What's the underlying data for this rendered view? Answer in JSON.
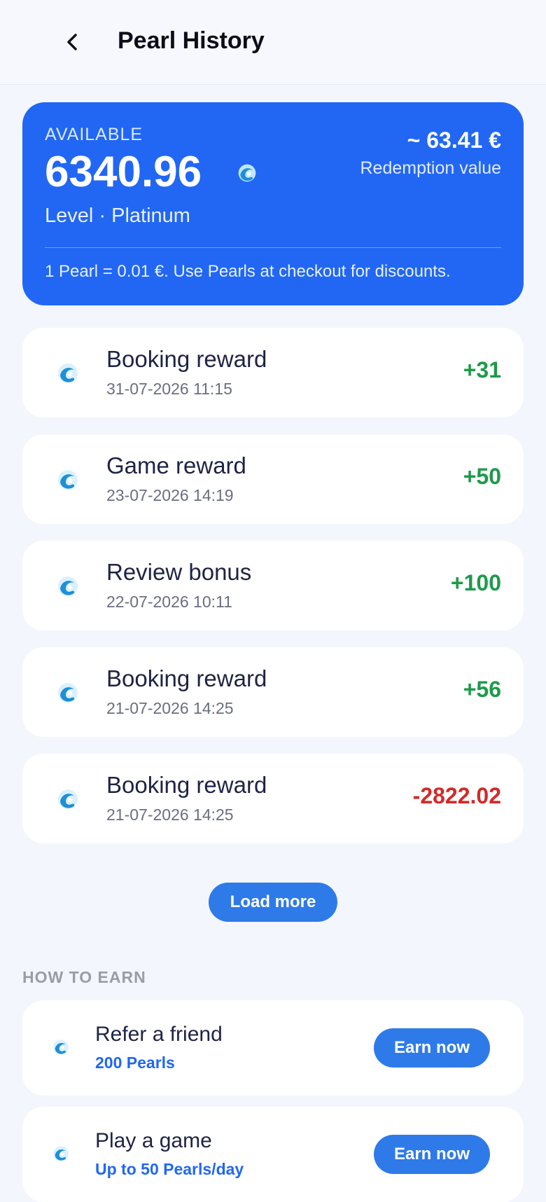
{
  "header": {
    "title": "Pearl History",
    "back_icon": "chevron-left-icon"
  },
  "balance": {
    "label": "AVAILABLE",
    "amount": "6340.96",
    "coin_icon": "pearl-icon",
    "level": "Level · Platinum",
    "value": "~ 63.41 €",
    "value_label": "Redemption value",
    "note": "1 Pearl = 0.01 €. Use Pearls at checkout for discounts.",
    "color": "#2167f3"
  },
  "transactions": [
    {
      "name": "Booking reward",
      "date": "31-07-2026 11:15",
      "amount": "+31"
    },
    {
      "name": "Game reward",
      "date": "23-07-2026 14:19",
      "amount": "+50"
    },
    {
      "name": "Review bonus",
      "date": "22-07-2026 10:11",
      "amount": "+100"
    },
    {
      "name": "Booking reward",
      "date": "21-07-2026 14:25",
      "amount": "+56"
    },
    {
      "name": "Booking reward",
      "date": "21-07-2026 14:25",
      "amount": "-2822.02"
    }
  ],
  "load_more_label": "Load more",
  "earn": {
    "heading": "HOW TO EARN",
    "items": [
      {
        "name": "Refer a friend",
        "reward": "200 Pearls",
        "button": "Earn now"
      },
      {
        "name": "Play a game",
        "reward": "Up to 50 Pearls/day",
        "button": "Earn now"
      }
    ]
  },
  "colors": {
    "positive": "#1e9a4a",
    "negative": "#d22a2a",
    "accent": "#2f7ae9"
  }
}
